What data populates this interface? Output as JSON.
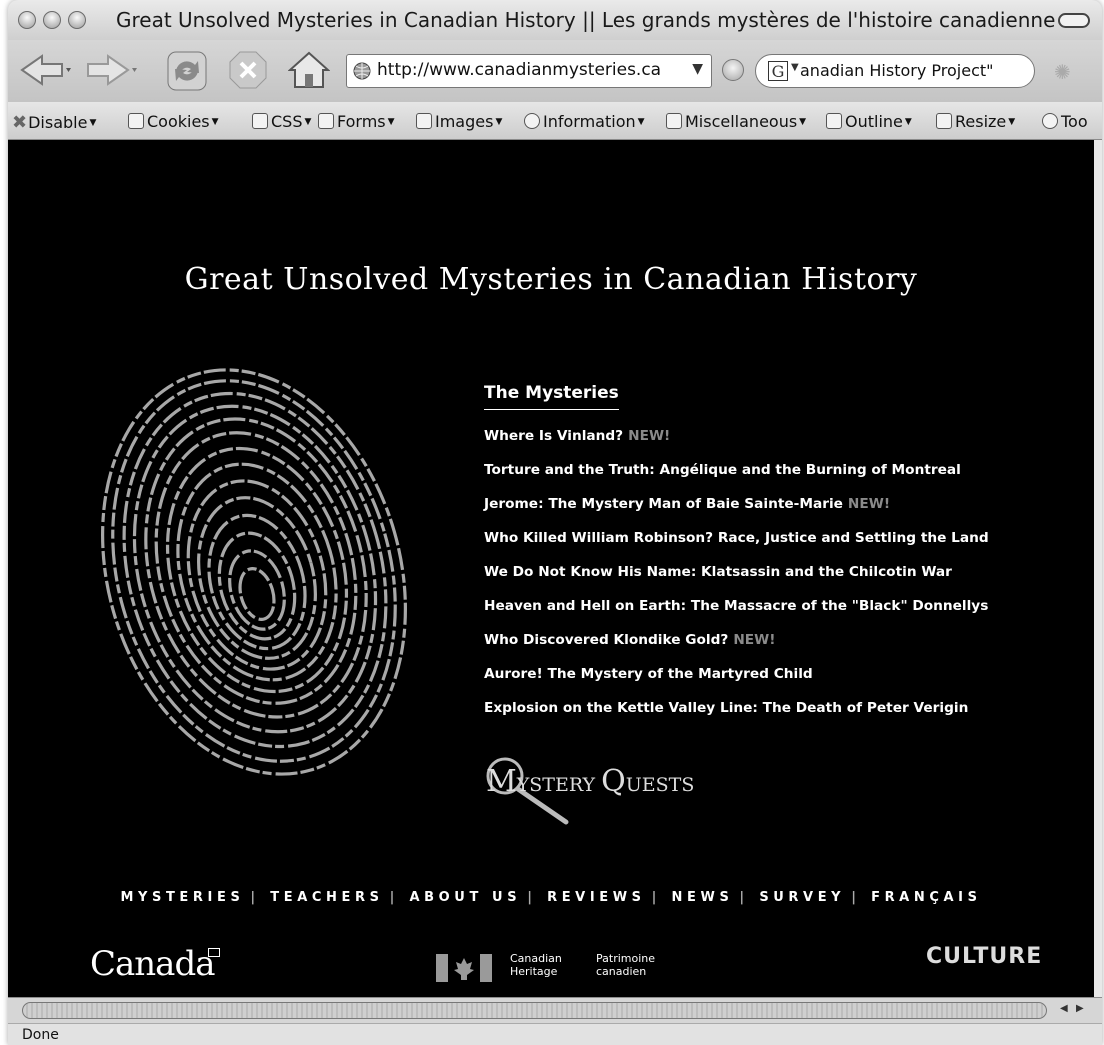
{
  "window": {
    "title": "Great Unsolved Mysteries in Canadian History || Les grands mystères de l'histoire canadienne"
  },
  "navbar": {
    "url": "http://www.canadianmysteries.ca",
    "search_value": "anadian History Project\""
  },
  "devbar": {
    "items": [
      "Disable",
      "Cookies",
      "CSS",
      "Forms",
      "Images",
      "Information",
      "Miscellaneous",
      "Outline",
      "Resize",
      "Too"
    ]
  },
  "page": {
    "title": "Great Unsolved Mysteries in Canadian History",
    "mysteries_heading": "The Mysteries",
    "new_label": "NEW!",
    "mysteries": [
      "Where Is Vinland?",
      "Torture and the Truth: Angélique and the Burning of Montreal",
      "Jerome: The Mystery Man of Baie Sainte-Marie",
      "Who Killed William Robinson? Race, Justice and Settling the Land",
      "We Do Not Know His Name: Klatsassin and the Chilcotin War",
      "Heaven and Hell on Earth: The Massacre of the \"Black\" Donnellys",
      "Who Discovered Klondike Gold?",
      "Aurore! The Mystery of the Martyred Child",
      "Explosion on the Kettle Valley Line: The Death of Peter Verigin"
    ],
    "mystery_quests": {
      "cap1": "M",
      "rest1": "YSTERY",
      "cap2": "Q",
      "rest2": "UESTS"
    },
    "footer_nav": [
      "MYSTERIES",
      "TEACHERS",
      "ABOUT US",
      "REVIEWS",
      "NEWS",
      "SURVEY",
      "FRANÇAIS"
    ],
    "canada_wordmark": "Canada",
    "heritage_en": [
      "Canadian",
      "Heritage"
    ],
    "heritage_fr": [
      "Patrimoine",
      "canadien"
    ],
    "culture_logo": "CULTURE"
  },
  "status": {
    "text": "Done"
  },
  "colors": {
    "page_bg": "#000000",
    "new_badge": "#8a8a8a"
  }
}
